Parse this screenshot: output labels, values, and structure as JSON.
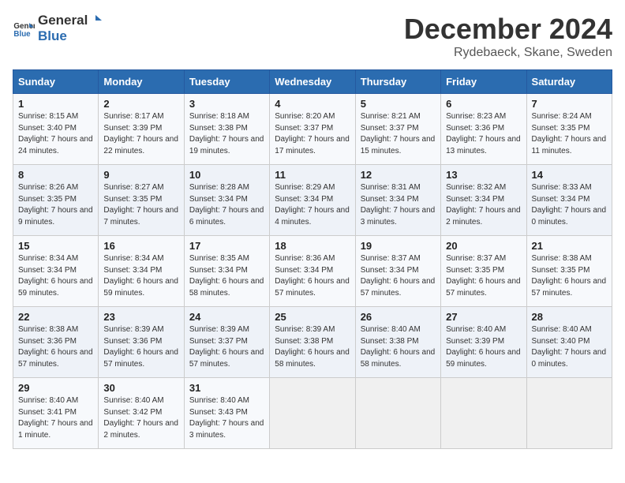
{
  "logo": {
    "line1": "General",
    "line2": "Blue"
  },
  "title": "December 2024",
  "location": "Rydebaeck, Skane, Sweden",
  "days_of_week": [
    "Sunday",
    "Monday",
    "Tuesday",
    "Wednesday",
    "Thursday",
    "Friday",
    "Saturday"
  ],
  "weeks": [
    [
      {
        "day": "1",
        "sunrise": "8:15 AM",
        "sunset": "3:40 PM",
        "daylight": "7 hours and 24 minutes."
      },
      {
        "day": "2",
        "sunrise": "8:17 AM",
        "sunset": "3:39 PM",
        "daylight": "7 hours and 22 minutes."
      },
      {
        "day": "3",
        "sunrise": "8:18 AM",
        "sunset": "3:38 PM",
        "daylight": "7 hours and 19 minutes."
      },
      {
        "day": "4",
        "sunrise": "8:20 AM",
        "sunset": "3:37 PM",
        "daylight": "7 hours and 17 minutes."
      },
      {
        "day": "5",
        "sunrise": "8:21 AM",
        "sunset": "3:37 PM",
        "daylight": "7 hours and 15 minutes."
      },
      {
        "day": "6",
        "sunrise": "8:23 AM",
        "sunset": "3:36 PM",
        "daylight": "7 hours and 13 minutes."
      },
      {
        "day": "7",
        "sunrise": "8:24 AM",
        "sunset": "3:35 PM",
        "daylight": "7 hours and 11 minutes."
      }
    ],
    [
      {
        "day": "8",
        "sunrise": "8:26 AM",
        "sunset": "3:35 PM",
        "daylight": "7 hours and 9 minutes."
      },
      {
        "day": "9",
        "sunrise": "8:27 AM",
        "sunset": "3:35 PM",
        "daylight": "7 hours and 7 minutes."
      },
      {
        "day": "10",
        "sunrise": "8:28 AM",
        "sunset": "3:34 PM",
        "daylight": "7 hours and 6 minutes."
      },
      {
        "day": "11",
        "sunrise": "8:29 AM",
        "sunset": "3:34 PM",
        "daylight": "7 hours and 4 minutes."
      },
      {
        "day": "12",
        "sunrise": "8:31 AM",
        "sunset": "3:34 PM",
        "daylight": "7 hours and 3 minutes."
      },
      {
        "day": "13",
        "sunrise": "8:32 AM",
        "sunset": "3:34 PM",
        "daylight": "7 hours and 2 minutes."
      },
      {
        "day": "14",
        "sunrise": "8:33 AM",
        "sunset": "3:34 PM",
        "daylight": "7 hours and 0 minutes."
      }
    ],
    [
      {
        "day": "15",
        "sunrise": "8:34 AM",
        "sunset": "3:34 PM",
        "daylight": "6 hours and 59 minutes."
      },
      {
        "day": "16",
        "sunrise": "8:34 AM",
        "sunset": "3:34 PM",
        "daylight": "6 hours and 59 minutes."
      },
      {
        "day": "17",
        "sunrise": "8:35 AM",
        "sunset": "3:34 PM",
        "daylight": "6 hours and 58 minutes."
      },
      {
        "day": "18",
        "sunrise": "8:36 AM",
        "sunset": "3:34 PM",
        "daylight": "6 hours and 57 minutes."
      },
      {
        "day": "19",
        "sunrise": "8:37 AM",
        "sunset": "3:34 PM",
        "daylight": "6 hours and 57 minutes."
      },
      {
        "day": "20",
        "sunrise": "8:37 AM",
        "sunset": "3:35 PM",
        "daylight": "6 hours and 57 minutes."
      },
      {
        "day": "21",
        "sunrise": "8:38 AM",
        "sunset": "3:35 PM",
        "daylight": "6 hours and 57 minutes."
      }
    ],
    [
      {
        "day": "22",
        "sunrise": "8:38 AM",
        "sunset": "3:36 PM",
        "daylight": "6 hours and 57 minutes."
      },
      {
        "day": "23",
        "sunrise": "8:39 AM",
        "sunset": "3:36 PM",
        "daylight": "6 hours and 57 minutes."
      },
      {
        "day": "24",
        "sunrise": "8:39 AM",
        "sunset": "3:37 PM",
        "daylight": "6 hours and 57 minutes."
      },
      {
        "day": "25",
        "sunrise": "8:39 AM",
        "sunset": "3:38 PM",
        "daylight": "6 hours and 58 minutes."
      },
      {
        "day": "26",
        "sunrise": "8:40 AM",
        "sunset": "3:38 PM",
        "daylight": "6 hours and 58 minutes."
      },
      {
        "day": "27",
        "sunrise": "8:40 AM",
        "sunset": "3:39 PM",
        "daylight": "6 hours and 59 minutes."
      },
      {
        "day": "28",
        "sunrise": "8:40 AM",
        "sunset": "3:40 PM",
        "daylight": "7 hours and 0 minutes."
      }
    ],
    [
      {
        "day": "29",
        "sunrise": "8:40 AM",
        "sunset": "3:41 PM",
        "daylight": "7 hours and 1 minute."
      },
      {
        "day": "30",
        "sunrise": "8:40 AM",
        "sunset": "3:42 PM",
        "daylight": "7 hours and 2 minutes."
      },
      {
        "day": "31",
        "sunrise": "8:40 AM",
        "sunset": "3:43 PM",
        "daylight": "7 hours and 3 minutes."
      },
      null,
      null,
      null,
      null
    ]
  ],
  "labels": {
    "sunrise": "Sunrise:",
    "sunset": "Sunset:",
    "daylight": "Daylight:"
  }
}
